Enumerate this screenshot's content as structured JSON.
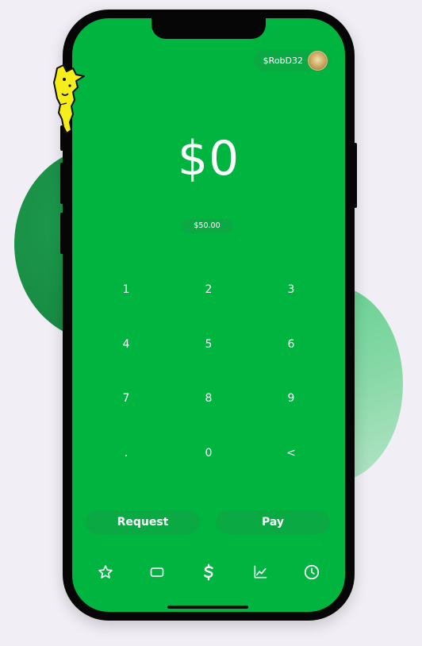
{
  "header": {
    "cashtag": "$RobD32"
  },
  "amount": {
    "display": "$0",
    "balance": "$50.00"
  },
  "keypad": {
    "keys": [
      "1",
      "2",
      "3",
      "4",
      "5",
      "6",
      "7",
      "8",
      "9",
      ".",
      "0",
      "<"
    ]
  },
  "actions": {
    "request_label": "Request",
    "pay_label": "Pay"
  },
  "tabs": [
    {
      "icon": "star-icon"
    },
    {
      "icon": "card-icon"
    },
    {
      "icon": "dollar-icon"
    },
    {
      "icon": "chart-icon"
    },
    {
      "icon": "clock-icon"
    }
  ],
  "colors": {
    "screen": "#00b53f",
    "pill": "#0ba944",
    "background": "#f1eff5",
    "phone_frame": "#060606",
    "text": "#ffffff"
  }
}
